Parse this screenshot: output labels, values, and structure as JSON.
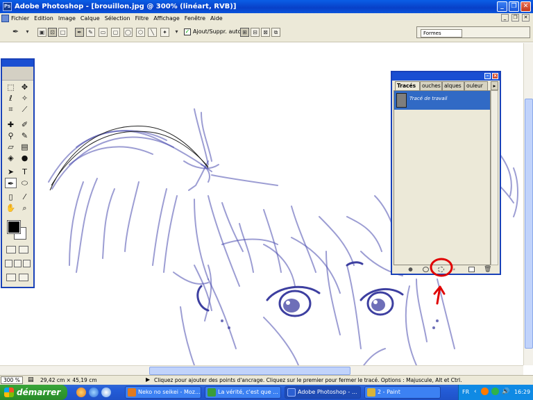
{
  "window": {
    "title": "Adobe Photoshop - [brouillon.jpg @ 300% (linéart, RVB)]",
    "app_icon": "Ps"
  },
  "menu": [
    "Fichier",
    "Edition",
    "Image",
    "Calque",
    "Sélection",
    "Filtre",
    "Affichage",
    "Fenêtre",
    "Aide"
  ],
  "options_bar": {
    "auto_add_delete_label": "Ajout/Suppr. auto",
    "auto_add_delete_checked": true,
    "palette_well_tab": "Formes"
  },
  "toolbox": {
    "selected_tool": "pen-tool",
    "foreground_color": "#000000",
    "background_color": "#ffffff"
  },
  "paths_panel": {
    "tabs": [
      "Tracés",
      "Couches",
      "Calques",
      "Couleur"
    ],
    "tabs_display": [
      "Tracés",
      "ouches",
      "alques",
      "ouleur"
    ],
    "active_tab": "Tracés",
    "items": [
      {
        "label": "Tracé de travail",
        "selected": true
      }
    ]
  },
  "status_bar": {
    "zoom": "300 %",
    "doc_size": "29,42 cm × 45,19 cm",
    "message": "Cliquez pour ajouter des points d'ancrage. Cliquez sur le premier pour fermer le tracé. Options : Majuscule, Alt et Ctrl."
  },
  "taskbar": {
    "start_label": "démarrer",
    "tasks": [
      {
        "label": "Neko no seikei - Moz...",
        "icon_color": "#e07a1f",
        "active": false
      },
      {
        "label": "La vérité, c'est que ...",
        "icon_color": "#3a9d3a",
        "active": false
      },
      {
        "label": "Adobe Photoshop - ...",
        "icon_color": "#2b5fd1",
        "active": true
      },
      {
        "label": "2 - Paint",
        "icon_color": "#d8b43a",
        "active": false
      }
    ],
    "tray": {
      "language": "FR",
      "clock": "16:29"
    }
  },
  "colors": {
    "titlebar": "#0840c8",
    "sketch_stroke": "#3d3fa0",
    "annotation": "#e00000",
    "selection": "#316ac5"
  }
}
